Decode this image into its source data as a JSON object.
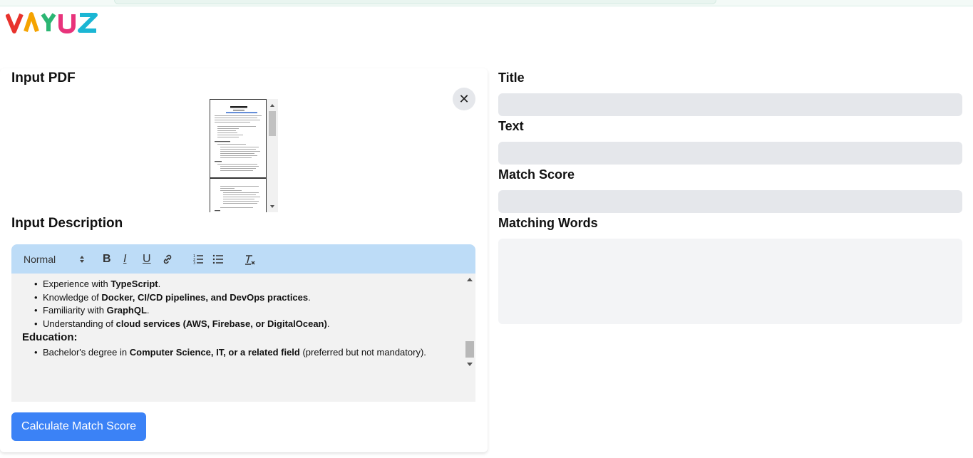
{
  "logo": {
    "text": "VAYUZ",
    "colors": [
      "#e8332d",
      "#f5a300",
      "#2bb673",
      "#e8337b",
      "#1bb6d4"
    ]
  },
  "left": {
    "pdf_title": "Input PDF",
    "desc_title": "Input Description",
    "pdf_preview": {
      "name_line": "PANKAJ KUMAR"
    },
    "close_icon": "close-icon",
    "toolbar": {
      "heading_select": "Normal",
      "icons": [
        "bold-icon",
        "italic-icon",
        "underline-icon",
        "link-icon",
        "ordered-list-icon",
        "bullet-list-icon",
        "clear-format-icon"
      ]
    },
    "editor": {
      "items": [
        {
          "pre": "Experience with ",
          "bold": "TypeScript",
          "post": "."
        },
        {
          "pre": "Knowledge of ",
          "bold": "Docker, CI/CD pipelines, and DevOps practices",
          "post": "."
        },
        {
          "pre": "Familiarity with ",
          "bold": "GraphQL",
          "post": "."
        },
        {
          "pre": "Understanding of ",
          "bold": "cloud services (AWS, Firebase, or DigitalOcean)",
          "post": "."
        }
      ],
      "education_heading": "Education:",
      "education_item": {
        "pre": "Bachelor's degree in ",
        "bold": "Computer Science, IT, or a related field",
        "post": " (preferred but not mandatory)."
      }
    },
    "calc_button": "Calculate Match Score"
  },
  "right": {
    "title_label": "Title",
    "text_label": "Text",
    "match_score_label": "Match Score",
    "matching_words_label": "Matching Words"
  }
}
